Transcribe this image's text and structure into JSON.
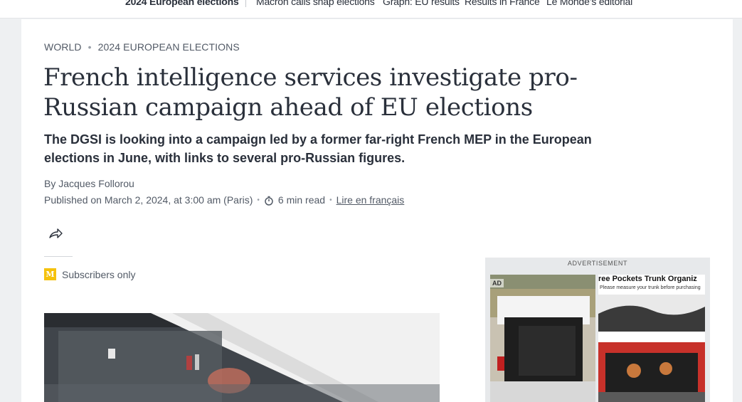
{
  "top_nav": {
    "items": [
      {
        "label": "2024 European elections",
        "bold": true
      },
      {
        "label": "Macron calls snap elections"
      },
      {
        "label": "Graph: EU results"
      },
      {
        "label": "Results in France"
      },
      {
        "label": "Le Monde’s editorial"
      }
    ]
  },
  "article": {
    "breadcrumbs": [
      "World",
      "2024 European elections"
    ],
    "title": "French intelligence services investigate pro-Russian campaign ahead of EU elections",
    "description": "The DGSI is looking into a campaign led by a former far-right French MEP in the European elections in June, with links to several pro-Russian figures.",
    "byline": "By Jacques Follorou",
    "published": "Published on March 2, 2024, at 3:00 am (Paris)",
    "read_time": "6 min read",
    "french_link": "Lire en français",
    "subscribers": "Subscribers only",
    "subscriber_badge": "M"
  },
  "ad": {
    "label": "Advertisement",
    "tag": "AD",
    "product_title": "ree Pockets Trunk Organiz",
    "product_note": "Please measure your trunk before purchasing",
    "badge_color": "#f5c20d"
  }
}
